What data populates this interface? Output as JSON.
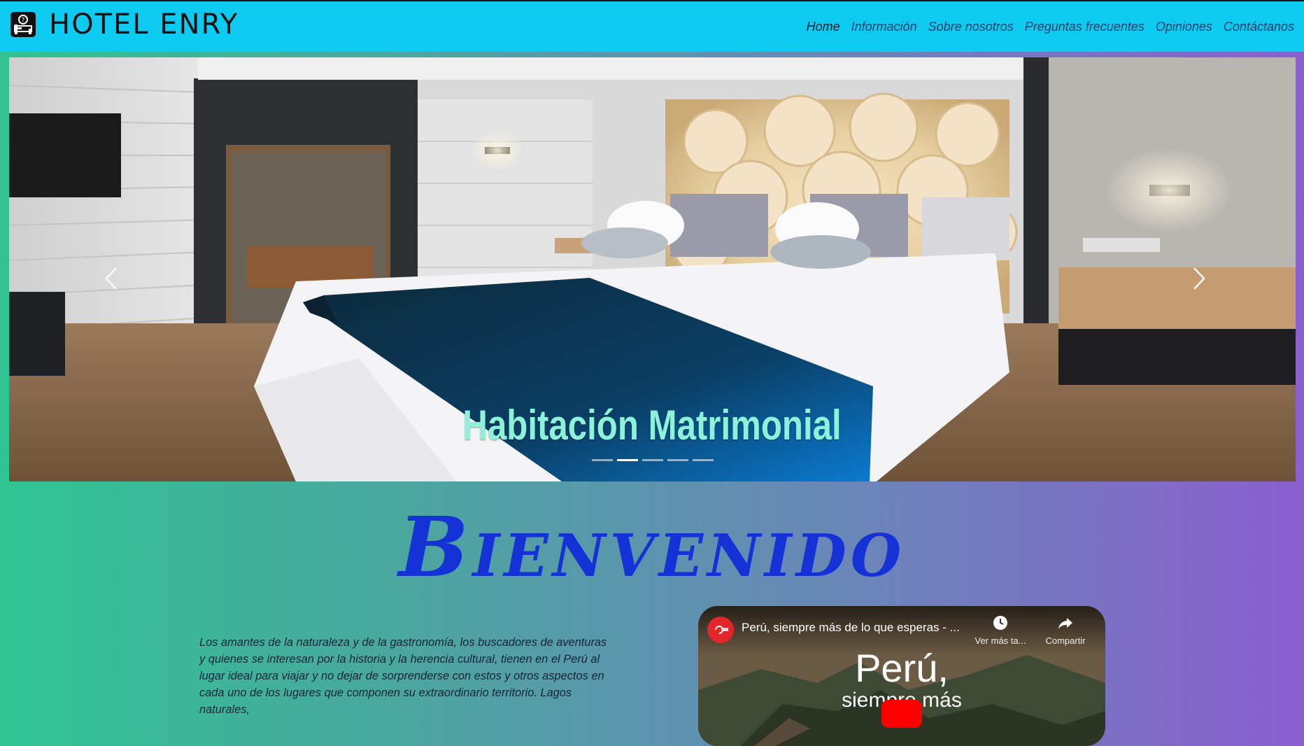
{
  "header": {
    "brand_name": "HOTEL ENRY",
    "brand_icon": "hotel-bed-icon",
    "nav": [
      {
        "label": "Home",
        "active": true
      },
      {
        "label": "Información"
      },
      {
        "label": "Sobre nosotros"
      },
      {
        "label": "Preguntas frecuentes"
      },
      {
        "label": "Opiniones"
      },
      {
        "label": "Contáctanos"
      }
    ],
    "bg_color": "#0dcaf0"
  },
  "carousel": {
    "caption": "Habitación Matrimonial",
    "slide_count": 5,
    "active_index": 1,
    "prev_icon": "chevron-left-icon",
    "next_icon": "chevron-right-icon",
    "caption_color": "#8cf3da"
  },
  "welcome": {
    "title": "Bienvenido",
    "title_color": "#1432d6",
    "intro": "Los amantes de la naturaleza y de la gastronomía, los buscadores de aventuras y quienes se interesan por la historia y la herencia cultural, tienen en el Perú al lugar ideal para viajar y no dejar de sorprenderse con estos y otros aspectos en cada uno de los lugares que componen su extraordinario territorio. Lagos naturales,"
  },
  "video": {
    "title": "Perú, siempre más de lo que esperas - ...",
    "watch_later": "Ver más ta...",
    "share": "Compartir",
    "overlay_big": "Perú,",
    "overlay_sub": "siempre más"
  }
}
